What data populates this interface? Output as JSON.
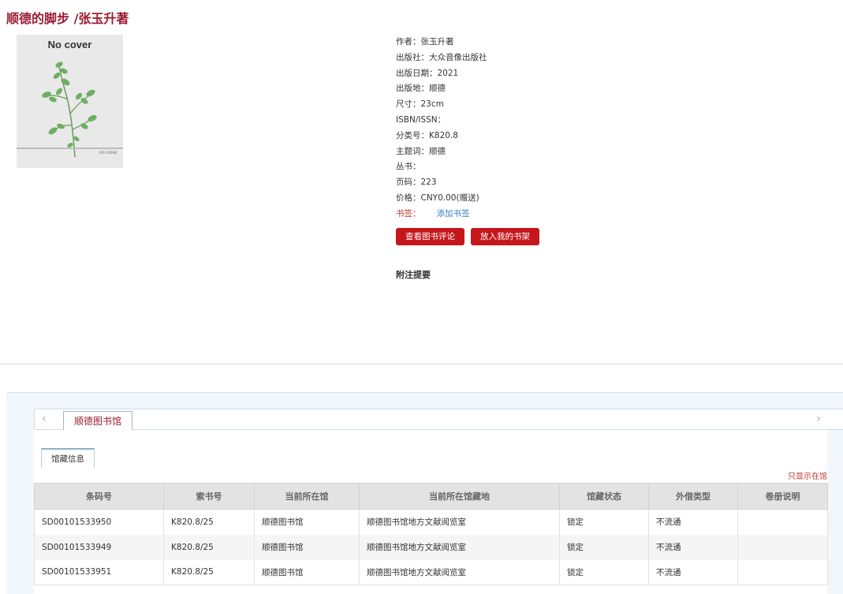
{
  "book": {
    "title": "顺德的脚步 /张玉升著",
    "cover": {
      "label": "No cover",
      "small": "no cover"
    }
  },
  "meta": [
    "作者：张玉升著",
    "出版社：大众音像出版社",
    "出版日期：2021",
    "出版地：顺德",
    "尺寸：23cm",
    "ISBN/ISSN：",
    "分类号：K820.8",
    "主题词：顺德",
    "丛书：",
    "页码：223",
    "价格：CNY0.00(赠送)"
  ],
  "bookmark": {
    "label": "书签：",
    "link": "添加书签"
  },
  "buttons": {
    "reviews": "查看图书评论",
    "shelf": "放入我的书架"
  },
  "note_title": "附注提要",
  "holdings": {
    "library_tab": "顺德图书馆",
    "sub_tab": "馆藏信息",
    "only_in_library": "只显示在馆",
    "arrow_left": "‹",
    "arrow_right": "›",
    "columns": [
      "条码号",
      "索书号",
      "当前所在馆",
      "当前所在馆藏地",
      "馆藏状态",
      "外借类型",
      "卷册说明"
    ],
    "rows": [
      [
        "SD00101533950",
        "K820.8/25",
        "顺德图书馆",
        "顺德图书馆地方文献阅览室",
        "锁定",
        "不流通",
        ""
      ],
      [
        "SD00101533949",
        "K820.8/25",
        "顺德图书馆",
        "顺德图书馆地方文献阅览室",
        "锁定",
        "不流通",
        ""
      ],
      [
        "SD00101533951",
        "K820.8/25",
        "顺德图书馆",
        "顺德图书馆地方文献阅览室",
        "锁定",
        "不流通",
        ""
      ]
    ]
  },
  "colors": {
    "title": "#9b1c31",
    "button": "#c4161c",
    "link": "#3a7fc1"
  }
}
